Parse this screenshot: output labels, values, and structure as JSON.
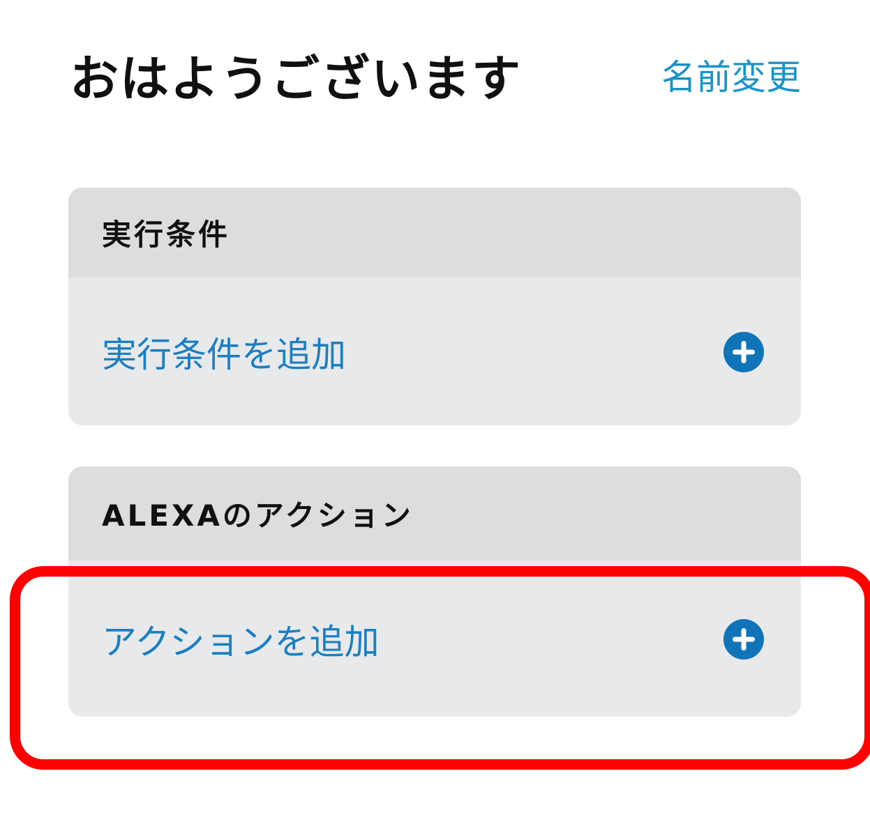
{
  "header": {
    "title": "おはようございます",
    "rename_label": "名前変更"
  },
  "trigger_section": {
    "heading": "実行条件",
    "add_label": "実行条件を追加",
    "add_icon": "plus-circle-icon"
  },
  "action_section": {
    "heading": "ALEXAのアクション",
    "add_label": "アクションを追加",
    "add_icon": "plus-circle-icon"
  },
  "colors": {
    "link": "#1b93c6",
    "row_link": "#1b7fc0",
    "icon": "#1173b8",
    "card_header_bg": "#dcdddf",
    "card_body_bg": "#e8e9ea",
    "highlight": "#ff0000"
  }
}
